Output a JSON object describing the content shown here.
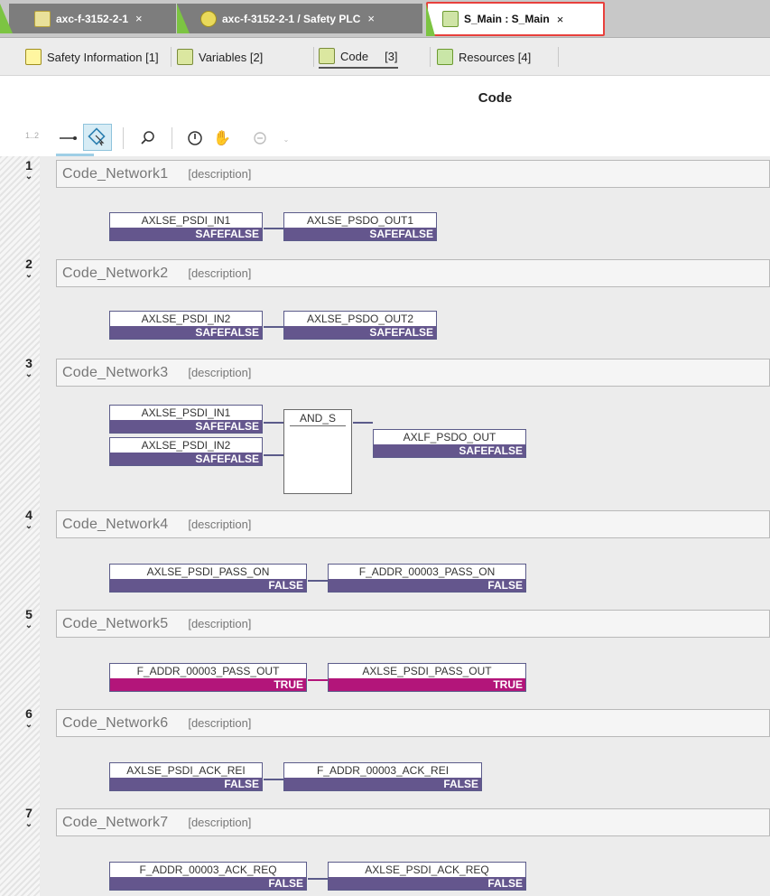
{
  "tabs": [
    {
      "label": "axc-f-3152-2-1",
      "close": "×",
      "icon": "controller-icon"
    },
    {
      "label": "axc-f-3152-2-1 / Safety PLC",
      "close": "×",
      "icon": "safety-plc-icon"
    },
    {
      "label": "S_Main : S_Main",
      "close": "×",
      "icon": "program-icon"
    }
  ],
  "subtabs": [
    {
      "label": "Safety Information [1]",
      "icon": "safety-info-icon"
    },
    {
      "label": "Variables [2]",
      "icon": "variables-icon"
    },
    {
      "label": "Code",
      "index": "[3]",
      "icon": "code-icon"
    },
    {
      "label": "Resources [4]",
      "icon": "resources-icon"
    }
  ],
  "heading": "Code",
  "toolbar": {
    "line_numbers": "1..2",
    "icons": [
      "connect-line-icon",
      "select-tool-icon",
      "search-icon",
      "power-icon",
      "hand-icon",
      "refresh-icon"
    ]
  },
  "colors": {
    "safe_bar": "#64568d",
    "true_bar": "#b3157a",
    "active_tab_border": "#e8403c",
    "tab_accent": "#7cc442"
  },
  "networks": [
    {
      "number": "1",
      "name": "Code_Network1",
      "description": "[description]",
      "inputs": [
        {
          "name": "AXLSE_PSDI_IN1",
          "value": "SAFEFALSE"
        }
      ],
      "output": {
        "name": "AXLSE_PSDO_OUT1",
        "value": "SAFEFALSE"
      }
    },
    {
      "number": "2",
      "name": "Code_Network2",
      "description": "[description]",
      "inputs": [
        {
          "name": "AXLSE_PSDI_IN2",
          "value": "SAFEFALSE"
        }
      ],
      "output": {
        "name": "AXLSE_PSDO_OUT2",
        "value": "SAFEFALSE"
      }
    },
    {
      "number": "3",
      "name": "Code_Network3",
      "description": "[description]",
      "function_block": "AND_S",
      "inputs": [
        {
          "name": "AXLSE_PSDI_IN1",
          "value": "SAFEFALSE"
        },
        {
          "name": "AXLSE_PSDI_IN2",
          "value": "SAFEFALSE"
        }
      ],
      "output": {
        "name": "AXLF_PSDO_OUT",
        "value": "SAFEFALSE"
      }
    },
    {
      "number": "4",
      "name": "Code_Network4",
      "description": "[description]",
      "inputs": [
        {
          "name": "AXLSE_PSDI_PASS_ON",
          "value": "FALSE"
        }
      ],
      "output": {
        "name": "F_ADDR_00003_PASS_ON",
        "value": "FALSE"
      }
    },
    {
      "number": "5",
      "name": "Code_Network5",
      "description": "[description]",
      "inputs": [
        {
          "name": "F_ADDR_00003_PASS_OUT",
          "value": "TRUE"
        }
      ],
      "output": {
        "name": "AXLSE_PSDI_PASS_OUT",
        "value": "TRUE"
      }
    },
    {
      "number": "6",
      "name": "Code_Network6",
      "description": "[description]",
      "inputs": [
        {
          "name": "AXLSE_PSDI_ACK_REI",
          "value": "FALSE"
        }
      ],
      "output": {
        "name": "F_ADDR_00003_ACK_REI",
        "value": "FALSE"
      }
    },
    {
      "number": "7",
      "name": "Code_Network7",
      "description": "[description]",
      "inputs": [
        {
          "name": "F_ADDR_00003_ACK_REQ",
          "value": "FALSE"
        }
      ],
      "output": {
        "name": "AXLSE_PSDI_ACK_REQ",
        "value": "FALSE"
      }
    }
  ]
}
